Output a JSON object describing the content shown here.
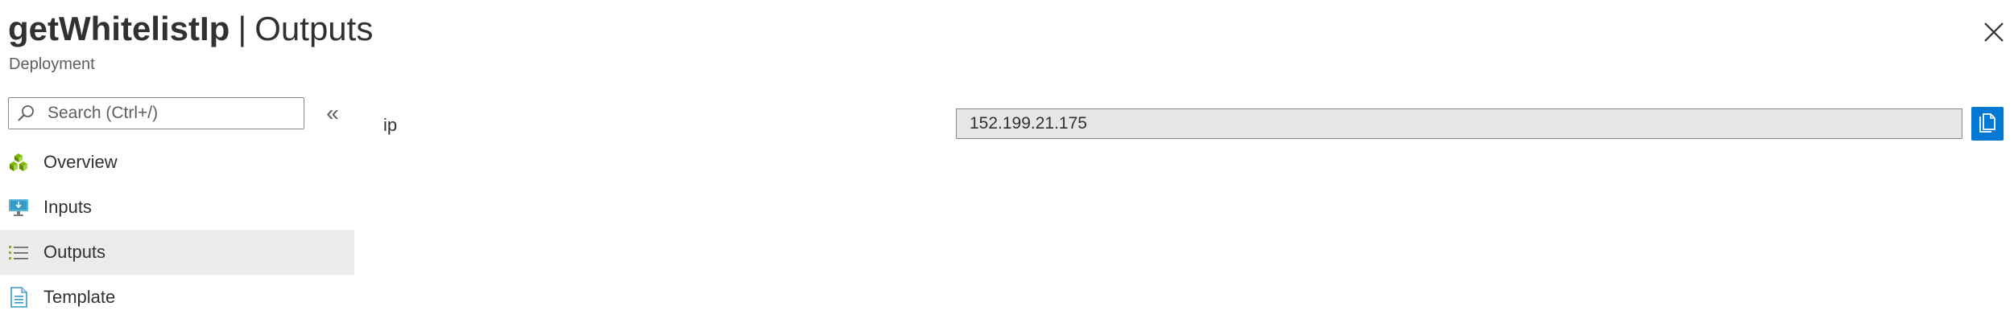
{
  "header": {
    "resource_name": "getWhitelistIp",
    "separator": "|",
    "section": "Outputs",
    "subtitle": "Deployment",
    "close_icon": "close-icon"
  },
  "search": {
    "placeholder": "Search (Ctrl+/)",
    "value": "",
    "icon": "search-icon"
  },
  "collapse": {
    "glyph": "«",
    "icon": "double-chevron-left-icon"
  },
  "sidebar": {
    "items": [
      {
        "label": "Overview",
        "icon": "overview-cubes-icon",
        "active": false
      },
      {
        "label": "Inputs",
        "icon": "inputs-monitor-icon",
        "active": false
      },
      {
        "label": "Outputs",
        "icon": "outputs-list-icon",
        "active": true
      },
      {
        "label": "Template",
        "icon": "template-document-icon",
        "active": false
      }
    ]
  },
  "outputs": [
    {
      "name": "ip",
      "value": "152.199.21.175",
      "copy_icon": "copy-icon"
    }
  ],
  "colors": {
    "accent": "#0078d4",
    "active_nav_bg": "#edebe9",
    "readonly_field_bg": "#e6e6e6"
  }
}
